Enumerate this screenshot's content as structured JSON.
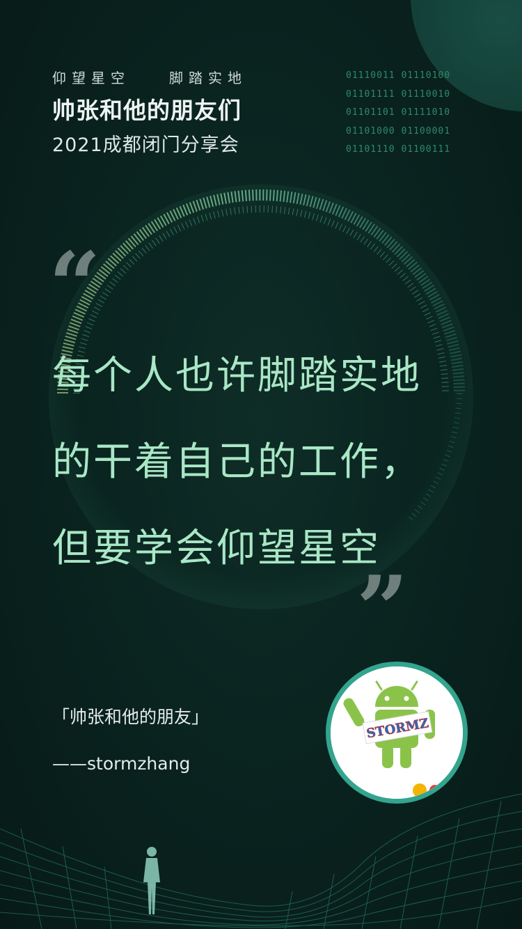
{
  "header": {
    "tagline_left": "仰望星空",
    "tagline_right": "脚踏实地",
    "title": "帅张和他的朋友们",
    "subtitle": "2021成都闭门分享会"
  },
  "binary_lines": [
    "01110011 01110100",
    "01101111 01110010",
    "01101101 01111010",
    "01101000 01100001",
    "01101110 01100111"
  ],
  "quote": {
    "open_mark": "“",
    "close_mark": "”",
    "lines": [
      "每个人也许脚踏实地",
      "的干着自己的工作，",
      "但要学会仰望星空"
    ]
  },
  "attribution": {
    "source": "「帅张和他的朋友」",
    "author": "——stormzhang"
  },
  "avatar": {
    "badge_text": "STORMZ"
  },
  "colors": {
    "background": "#0a2420",
    "quote_text": "#a9e7c6",
    "accent": "#33a48e",
    "binary": "#2e8a6a"
  }
}
